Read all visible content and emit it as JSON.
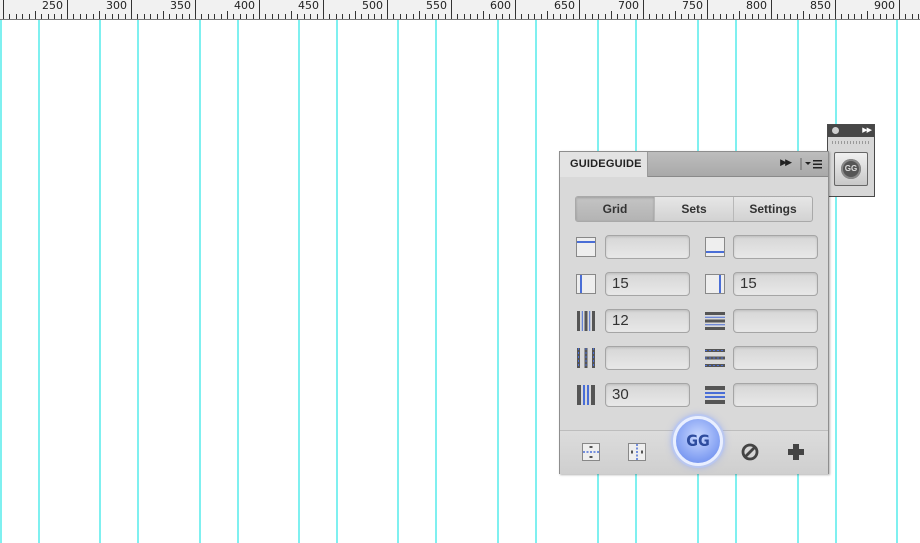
{
  "ruler": {
    "labels": [
      "250",
      "300",
      "350",
      "400",
      "450",
      "500",
      "550",
      "600",
      "650",
      "700",
      "750",
      "800",
      "850",
      "900"
    ]
  },
  "panel": {
    "title": "GUIDEGUIDE",
    "tabs": [
      "Grid",
      "Sets",
      "Settings"
    ],
    "active_tab": "Grid",
    "fields": {
      "top_margin": "",
      "bottom_margin": "",
      "left_margin": "15",
      "right_margin": "15",
      "columns": "12",
      "rows": "",
      "column_midpoint": "",
      "row_midpoint": "",
      "column_gutter": "30",
      "row_gutter": ""
    },
    "gg_button": "GG"
  },
  "mini_panel": {
    "gg_button": "GG"
  },
  "colors": {
    "guide": "#7ff0f0",
    "accent": "#7e9cf2"
  }
}
